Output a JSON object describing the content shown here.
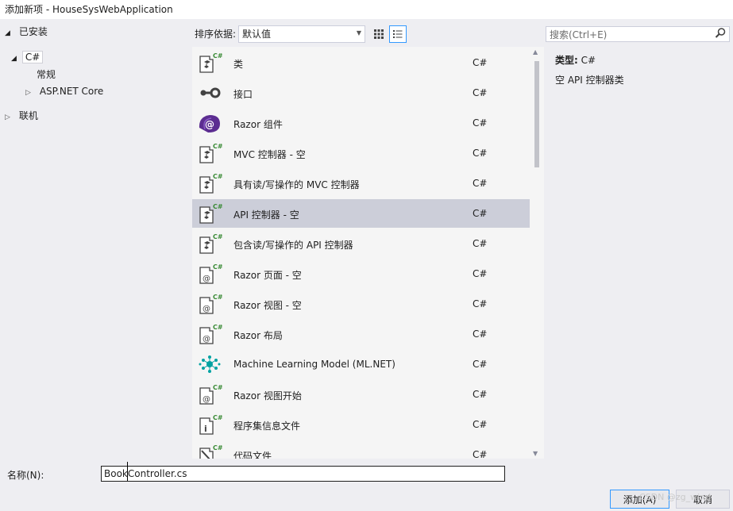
{
  "window": {
    "title": "添加新项 - HouseSysWebApplication"
  },
  "tree": {
    "installed": "已安装",
    "csharp": "C#",
    "general": "常规",
    "aspnet": "ASP.NET Core",
    "online": "联机"
  },
  "toolbar": {
    "sort_label": "排序依据:",
    "sort_value": "默认值",
    "search_placeholder": "搜索(Ctrl+E)"
  },
  "templates": [
    {
      "name": "类",
      "lang": "C#",
      "icon": "csharp-class-icon"
    },
    {
      "name": "接口",
      "lang": "C#",
      "icon": "interface-icon"
    },
    {
      "name": "Razor 组件",
      "lang": "C#",
      "icon": "razor-component-icon"
    },
    {
      "name": "MVC 控制器 - 空",
      "lang": "C#",
      "icon": "controller-icon"
    },
    {
      "name": "具有读/写操作的 MVC 控制器",
      "lang": "C#",
      "icon": "controller-icon"
    },
    {
      "name": "API 控制器 - 空",
      "lang": "C#",
      "icon": "controller-icon",
      "selected": true
    },
    {
      "name": "包含读/写操作的 API 控制器",
      "lang": "C#",
      "icon": "controller-icon"
    },
    {
      "name": "Razor 页面 - 空",
      "lang": "C#",
      "icon": "razor-page-icon"
    },
    {
      "name": "Razor 视图 - 空",
      "lang": "C#",
      "icon": "razor-page-icon"
    },
    {
      "name": "Razor 布局",
      "lang": "C#",
      "icon": "razor-page-icon"
    },
    {
      "name": "Machine Learning Model (ML.NET)",
      "lang": "C#",
      "icon": "ml-model-icon"
    },
    {
      "name": "Razor 视图开始",
      "lang": "C#",
      "icon": "razor-page-icon"
    },
    {
      "name": "程序集信息文件",
      "lang": "C#",
      "icon": "assembly-info-icon"
    },
    {
      "name": "代码文件",
      "lang": "C#",
      "icon": "code-file-icon"
    }
  ],
  "details": {
    "type_label": "类型:",
    "type_value": "C#",
    "description": "空 API 控制器类"
  },
  "bottom": {
    "name_label": "名称(N):",
    "name_value": "BookController.cs",
    "add_label": "添加(A)",
    "cancel_label": "取消"
  },
  "watermark": "CSDN @zg_wind",
  "colors": {
    "selection": "#ccced9",
    "accent": "#3399ff",
    "csharp_green": "#388a34",
    "razor_purple": "#5c2d91",
    "ml_teal": "#00a2a2"
  }
}
